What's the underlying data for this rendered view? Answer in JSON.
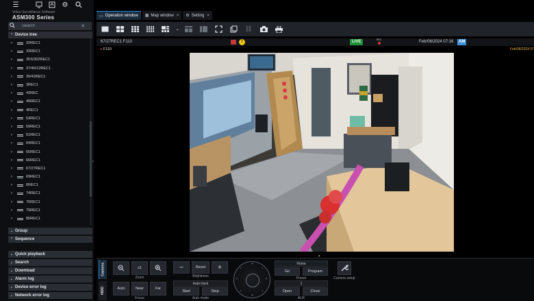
{
  "app": {
    "subtitle": "Video Surveillance Software",
    "name": "ASM300 Series"
  },
  "search": {
    "placeholder": "Search",
    "value": ""
  },
  "sections": {
    "device_tree": "Device tree",
    "group": "Group",
    "sequence": "Sequence",
    "quick_playback": "Quick playback",
    "search": "Search",
    "download": "Download",
    "alarm_log": "Alarm log",
    "device_error_log": "Device error log",
    "network_error_log": "Network error log"
  },
  "device_tree": {
    "items": [
      "32REC1",
      "33REC1",
      "35S/302REC1",
      "37/46/12REC1",
      "39/42REC1",
      "3REC1",
      "43REC",
      "45REC1",
      "4REC1",
      "53REC1",
      "59REC1",
      "61REC1",
      "64REC1",
      "65REC1",
      "66REC1",
      "67/27REC1",
      "69REC1",
      "6REC1",
      "74REC1",
      "76REC1",
      "79REC1",
      "80REC1"
    ]
  },
  "tabs": [
    {
      "label": "Operation window",
      "icon": "operation-window-icon",
      "active": true
    },
    {
      "label": "Map window",
      "icon": "map-icon",
      "active": false
    },
    {
      "label": "Setting",
      "icon": "gear-icon",
      "active": false
    }
  ],
  "camera_header": {
    "name": "67/27REC1 F110",
    "live": "LIVE",
    "rec": "REC",
    "date": "Feb/08/2024 07:16",
    "ampm": "AM"
  },
  "video": {
    "label": "F110",
    "timestamp": "Feb/08/2024 07"
  },
  "controls": {
    "tab_camera": "Camera",
    "tab_hdd": "HDD",
    "zoom_x1": "x1",
    "zoom_label": "Zoom",
    "focus_auto": "Auto",
    "focus_near": "Near",
    "focus_far": "Far",
    "focus_label": "Focus",
    "brightness_reset": "Reset",
    "brightness_label": "Brightness",
    "auto_mode_value": "Auto track",
    "auto_mode_start": "Start",
    "auto_mode_stop": "Stop",
    "auto_mode_label": "Auto mode",
    "preset_value": "Home",
    "preset_go": "Go",
    "preset_program": "Program",
    "preset_label": "Preset",
    "aux_value": "1",
    "aux_open": "Open",
    "aux_close": "Close",
    "aux_label": "AUX",
    "camera_setup": "Camera setup"
  },
  "colors": {
    "accent": "#2e8bd8",
    "live": "#1f8f3a",
    "alert": "#f0c419",
    "rec": "#e0302f"
  }
}
